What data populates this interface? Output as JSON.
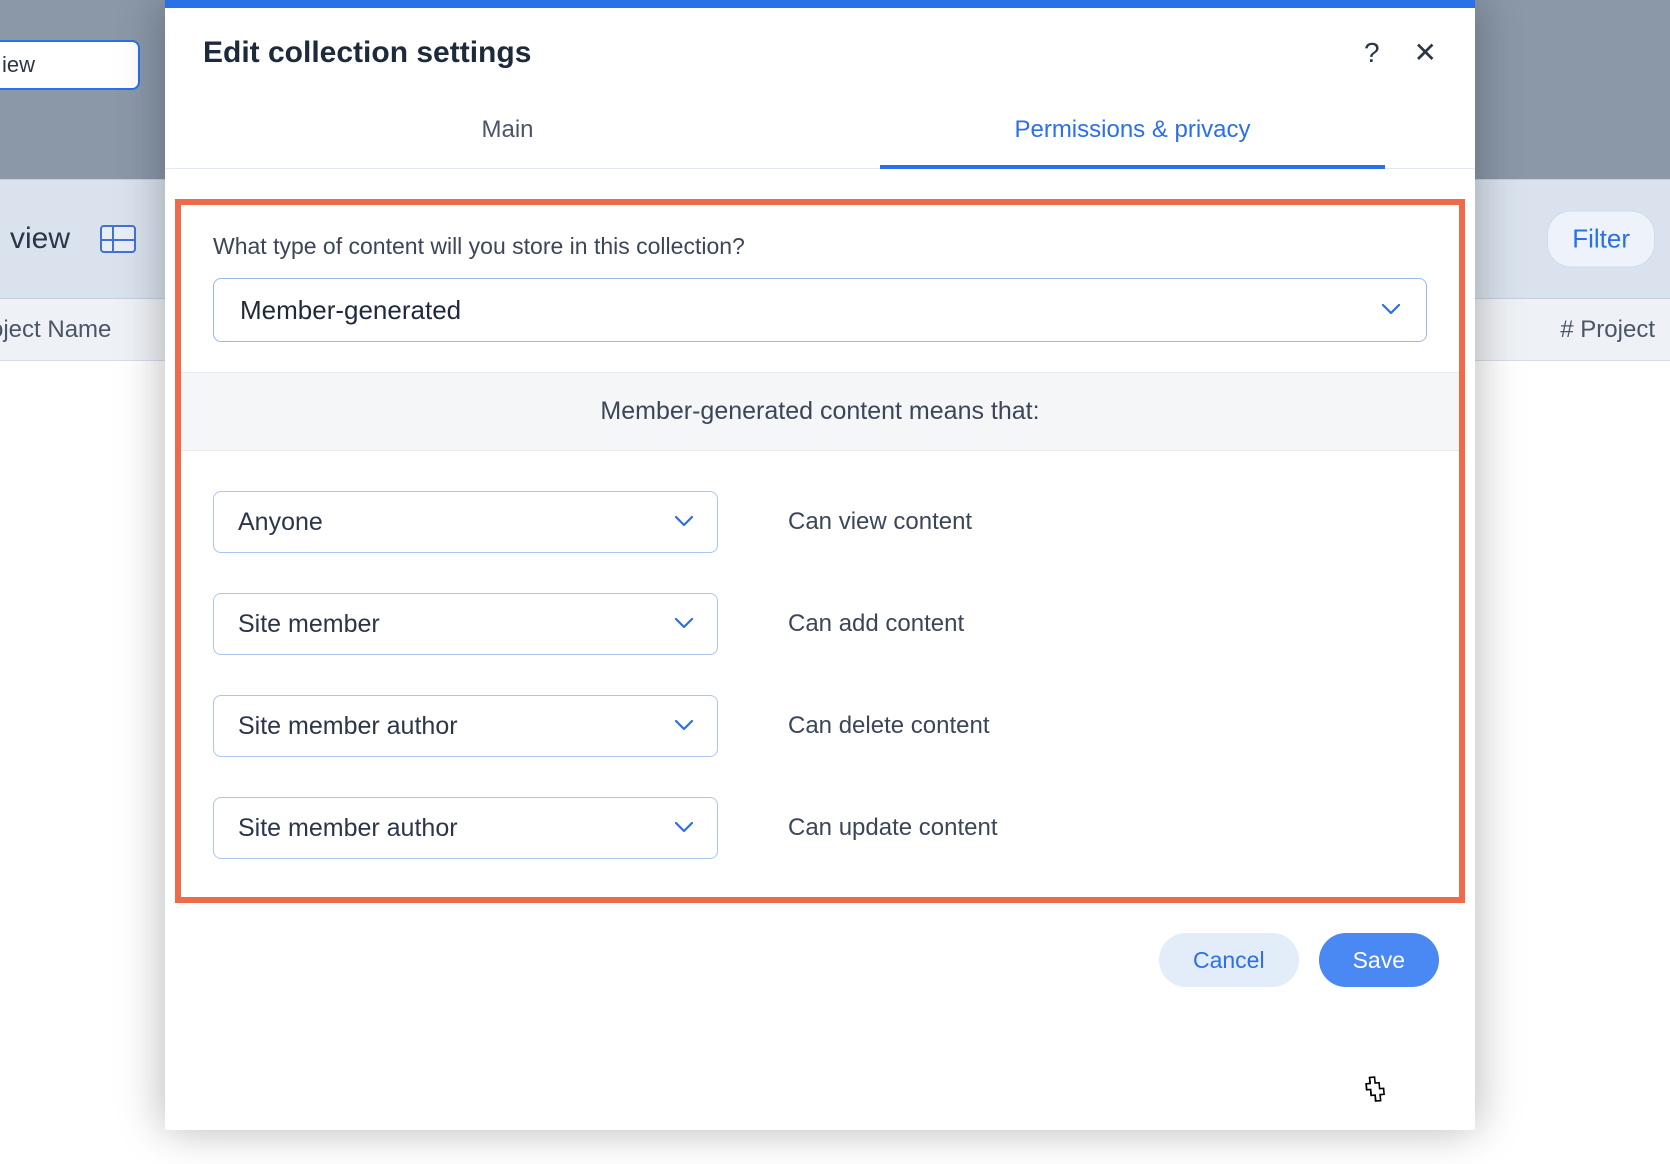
{
  "background": {
    "chipTop": "iew",
    "viewLabel": "view",
    "filterLabel": "Filter",
    "col1": "oject Name",
    "col2": "# Project"
  },
  "modal": {
    "title": "Edit collection settings",
    "tabs": {
      "main": "Main",
      "permissions": "Permissions & privacy"
    },
    "question": "What type of content will you store in this collection?",
    "contentTypeSelected": "Member-generated",
    "infoBanner": "Member-generated content means that:",
    "permissions": [
      {
        "role": "Anyone",
        "label": "Can view content"
      },
      {
        "role": "Site member",
        "label": "Can add content"
      },
      {
        "role": "Site member author",
        "label": "Can delete content"
      },
      {
        "role": "Site member author",
        "label": "Can update content"
      }
    ],
    "buttons": {
      "cancel": "Cancel",
      "save": "Save"
    }
  }
}
